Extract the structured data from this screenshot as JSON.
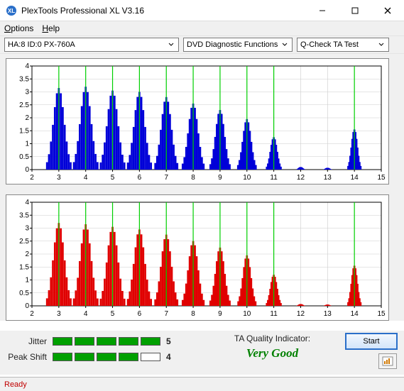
{
  "window": {
    "title": "PlexTools Professional XL V3.16"
  },
  "menu": {
    "options": "Options",
    "options_u": "O",
    "help": "Help",
    "help_u": "H"
  },
  "toolbar": {
    "device": "HA:8 ID:0   PX-760A",
    "category": "DVD Diagnostic Functions",
    "test": "Q-Check TA Test"
  },
  "metrics": {
    "jitter_label": "Jitter",
    "jitter_value": "5",
    "jitter_bars": 5,
    "peak_label": "Peak Shift",
    "peak_value": "4",
    "peak_bars": 4
  },
  "quality": {
    "label": "TA Quality Indicator:",
    "value": "Very Good"
  },
  "buttons": {
    "start": "Start"
  },
  "status": {
    "text": "Ready"
  },
  "chart_data": [
    {
      "type": "bar",
      "color": "#0000d8",
      "xlabel": "",
      "ylabel": "",
      "xlim": [
        2,
        15
      ],
      "ylim": [
        0,
        4
      ],
      "xticks": [
        2,
        3,
        4,
        5,
        6,
        7,
        8,
        9,
        10,
        11,
        12,
        13,
        14,
        15
      ],
      "yticks": [
        0,
        0.5,
        1,
        1.5,
        2,
        2.5,
        3,
        3.5,
        4
      ],
      "markers": [
        3,
        4,
        5,
        6,
        7,
        8,
        9,
        10,
        11,
        14
      ],
      "clusters": [
        {
          "center": 3,
          "peak": 3.15,
          "width": 0.88
        },
        {
          "center": 4,
          "peak": 3.2,
          "width": 0.88
        },
        {
          "center": 5,
          "peak": 3.05,
          "width": 0.88
        },
        {
          "center": 6,
          "peak": 3.0,
          "width": 0.86
        },
        {
          "center": 7,
          "peak": 2.8,
          "width": 0.82
        },
        {
          "center": 8,
          "peak": 2.55,
          "width": 0.78
        },
        {
          "center": 9,
          "peak": 2.3,
          "width": 0.72
        },
        {
          "center": 10,
          "peak": 1.95,
          "width": 0.66
        },
        {
          "center": 11,
          "peak": 1.25,
          "width": 0.52
        },
        {
          "center": 12,
          "peak": 0.1,
          "width": 0.3
        },
        {
          "center": 13,
          "peak": 0.07,
          "width": 0.3
        },
        {
          "center": 14,
          "peak": 1.55,
          "width": 0.46
        }
      ]
    },
    {
      "type": "bar",
      "color": "#e00000",
      "xlabel": "",
      "ylabel": "",
      "xlim": [
        2,
        15
      ],
      "ylim": [
        0,
        4
      ],
      "xticks": [
        2,
        3,
        4,
        5,
        6,
        7,
        8,
        9,
        10,
        11,
        12,
        13,
        14,
        15
      ],
      "yticks": [
        0,
        0.5,
        1,
        1.5,
        2,
        2.5,
        3,
        3.5,
        4
      ],
      "markers": [
        3,
        4,
        5,
        6,
        7,
        8,
        9,
        10,
        11,
        14
      ],
      "clusters": [
        {
          "center": 3,
          "peak": 3.2,
          "width": 0.88
        },
        {
          "center": 4,
          "peak": 3.15,
          "width": 0.88
        },
        {
          "center": 5,
          "peak": 3.05,
          "width": 0.88
        },
        {
          "center": 6,
          "peak": 2.95,
          "width": 0.86
        },
        {
          "center": 7,
          "peak": 2.75,
          "width": 0.82
        },
        {
          "center": 8,
          "peak": 2.5,
          "width": 0.78
        },
        {
          "center": 9,
          "peak": 2.25,
          "width": 0.72
        },
        {
          "center": 10,
          "peak": 1.95,
          "width": 0.64
        },
        {
          "center": 11,
          "peak": 1.2,
          "width": 0.52
        },
        {
          "center": 12,
          "peak": 0.07,
          "width": 0.3
        },
        {
          "center": 13,
          "peak": 0.05,
          "width": 0.3
        },
        {
          "center": 14,
          "peak": 1.55,
          "width": 0.46
        }
      ]
    }
  ]
}
